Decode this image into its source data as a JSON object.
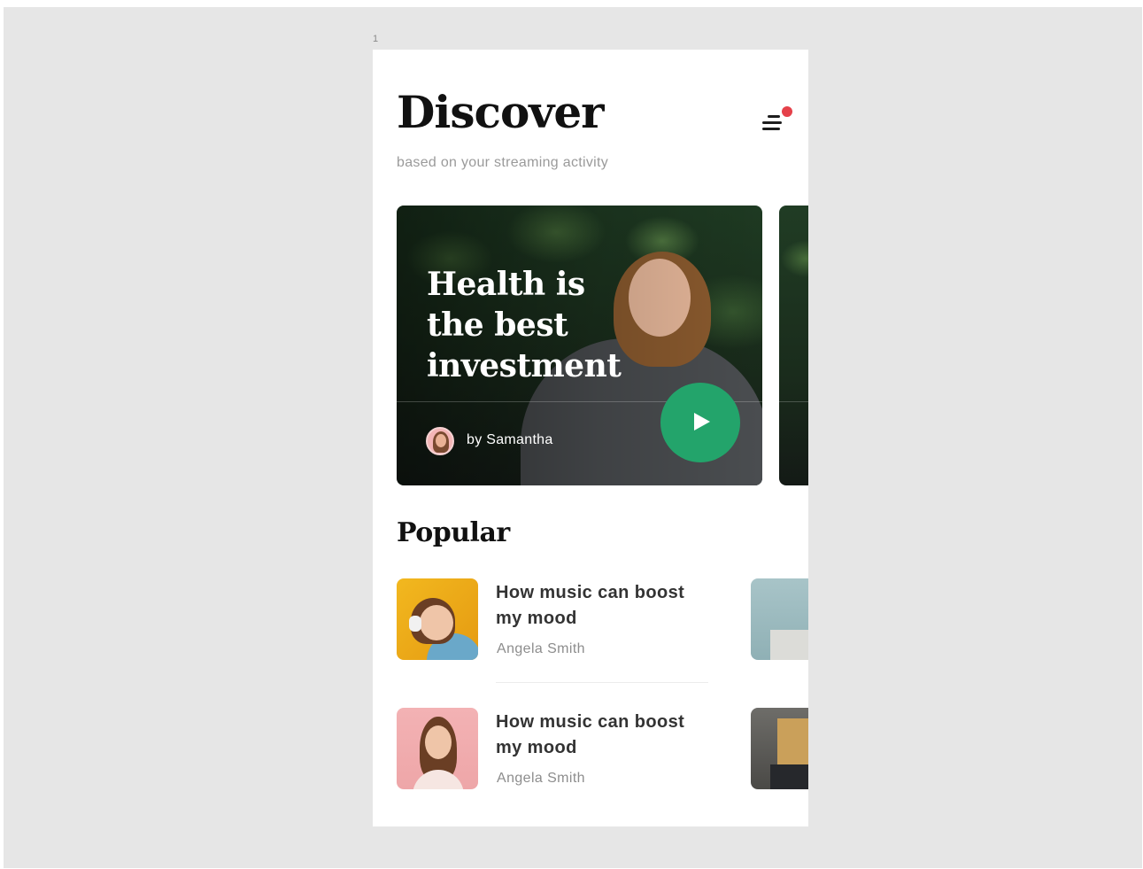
{
  "artboard": {
    "label": "1"
  },
  "header": {
    "title": "Discover",
    "subtitle": "based on your streaming activity",
    "menu_icon": "menu-icon",
    "notification_color": "#e5414a"
  },
  "featured": {
    "title": "Health is\nthe best\ninvestment",
    "author": "by Samantha",
    "play_icon": "play-icon",
    "accent_color": "#23a46b"
  },
  "popular": {
    "heading": "Popular",
    "items": [
      {
        "title": "How music can boost\nmy mood",
        "author": "Angela Smith"
      },
      {
        "title": "How music can boost\nmy mood",
        "author": "Angela Smith"
      }
    ]
  }
}
